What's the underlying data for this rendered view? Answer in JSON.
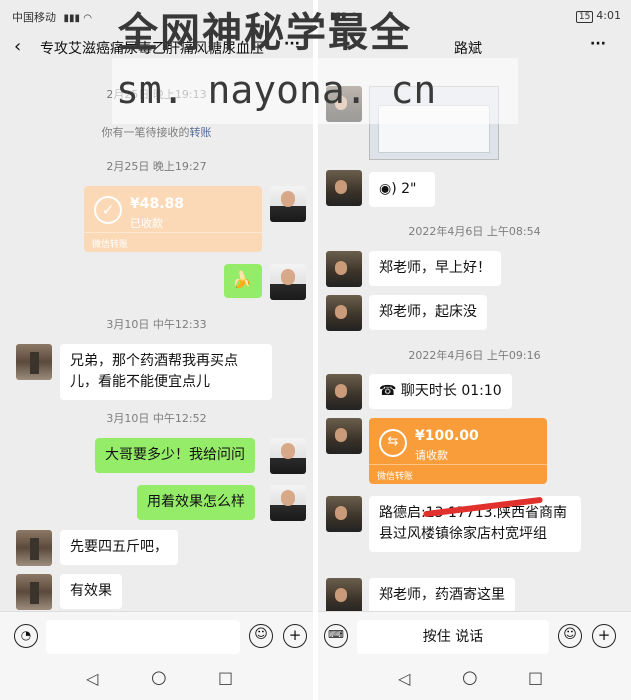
{
  "watermark": {
    "line1": "全网神秘学最全",
    "line2": "sm. nayona. cn"
  },
  "left": {
    "status": {
      "carrier": "中国移动",
      "right": ""
    },
    "back_icon": "chevron-left-icon",
    "title": "专攻艾滋癌痛尿毒乙肝痛风糖尿血压",
    "more_label": "···",
    "time_top": "2月25日 晚上19:13",
    "pending_notice": "你有一笔待接收的",
    "pending_link": "转账",
    "time1": "2月25日 晚上19:27",
    "transfer": {
      "amount": "¥48.88",
      "status": "已收款",
      "footer": "微信转账",
      "color": "#fbd9b6"
    },
    "emoji": "🍌",
    "time2": "3月10日 中午12:33",
    "msg_friend1": "兄弟，那个药酒帮我再买点儿，看能不能便宜点儿",
    "time3": "3月10日 中午12:52",
    "msg_me1": "大哥要多少！我给问问",
    "msg_me2": "用着效果怎么样",
    "msg_friend2": "先要四五斤吧，",
    "msg_friend3": "有效果",
    "voice_icon": "voice-icon",
    "emoji_icon": "smiley-icon",
    "plus_icon": "plus-icon",
    "nav": {
      "back": "◁",
      "home": "○",
      "recent": "□"
    }
  },
  "right": {
    "status": {
      "right": "4:01",
      "battery": "15"
    },
    "title": "路斌",
    "more_label": "···",
    "voice_msg": "2\"",
    "time1": "2022年4月6日 上午08:54",
    "msg1": "郑老师，早上好！",
    "msg2": "郑老师，起床没",
    "time2": "2022年4月6日 上午09:16",
    "call": "聊天时长 01:10",
    "transfer": {
      "amount": "¥100.00",
      "status": "请收款",
      "footer": "微信转账",
      "color": "#f99d3a"
    },
    "address": "路德启:13      17713.陕西省商南县过风楼镇徐家店村宽坪组",
    "msg3": "郑老师，药酒寄这里",
    "hold_to_talk": "按住 说话",
    "keyboard_icon": "keyboard-icon",
    "emoji_icon": "smiley-icon",
    "plus_icon": "plus-icon",
    "nav": {
      "back": "◁",
      "home": "○",
      "recent": "□"
    }
  }
}
